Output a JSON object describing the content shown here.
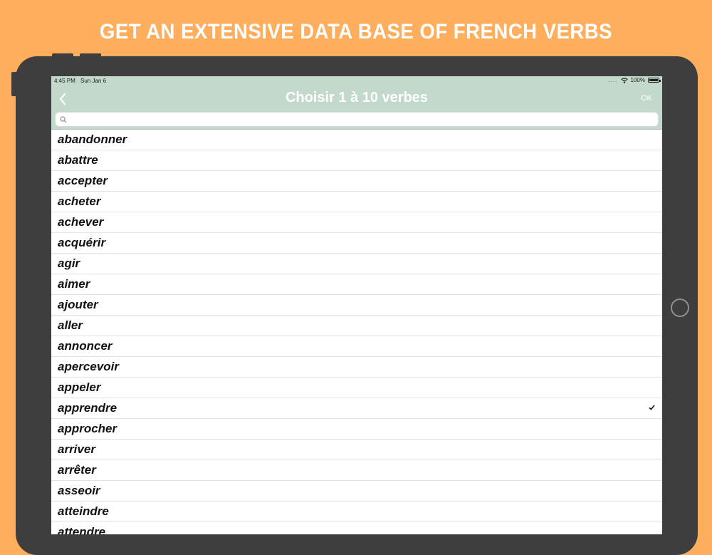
{
  "headline": "GET AN EXTENSIVE DATA BASE OF FRENCH VERBS",
  "status_bar": {
    "time": "4:45 PM",
    "date": "Sun Jan 6",
    "signal_dots": "....",
    "battery": "100%"
  },
  "nav": {
    "title": "Choisir 1 à 10 verbes",
    "ok_label": "OK",
    "back_icon": "chevron-left-icon"
  },
  "search": {
    "placeholder": "",
    "value": ""
  },
  "colors": {
    "background": "#ffae5e",
    "device": "#3e3e3e",
    "nav_bar": "#c2d9cb",
    "title_text": "#ffffff"
  },
  "verbs": [
    {
      "label": "abandonner",
      "checked": false
    },
    {
      "label": "abattre",
      "checked": false
    },
    {
      "label": "accepter",
      "checked": false
    },
    {
      "label": "acheter",
      "checked": false
    },
    {
      "label": "achever",
      "checked": false
    },
    {
      "label": "acquérir",
      "checked": false
    },
    {
      "label": "agir",
      "checked": false
    },
    {
      "label": "aimer",
      "checked": false
    },
    {
      "label": "ajouter",
      "checked": false
    },
    {
      "label": "aller",
      "checked": false
    },
    {
      "label": "annoncer",
      "checked": false
    },
    {
      "label": "apercevoir",
      "checked": false
    },
    {
      "label": "appeler",
      "checked": false
    },
    {
      "label": "apprendre",
      "checked": true
    },
    {
      "label": "approcher",
      "checked": false
    },
    {
      "label": "arriver",
      "checked": false
    },
    {
      "label": "arrêter",
      "checked": false
    },
    {
      "label": "asseoir",
      "checked": false
    },
    {
      "label": "atteindre",
      "checked": false
    },
    {
      "label": "attendre",
      "checked": false
    },
    {
      "label": "attendre",
      "checked": false
    }
  ]
}
